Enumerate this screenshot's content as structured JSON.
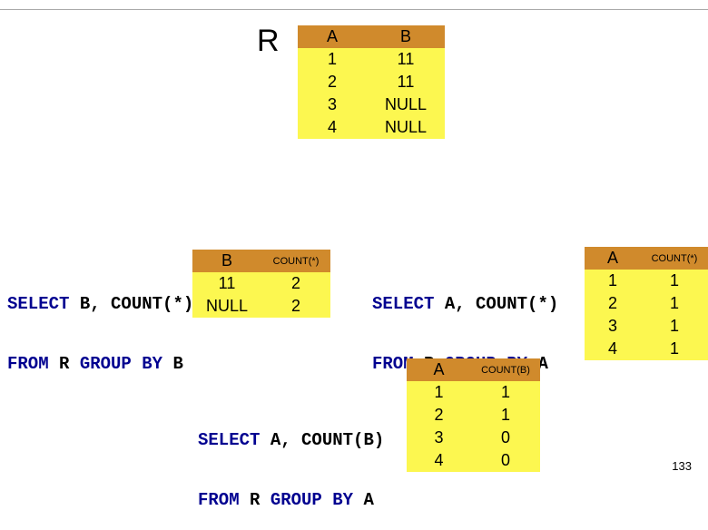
{
  "label_R": "R",
  "page_number": "133",
  "top_table": {
    "headers": [
      "A",
      "B"
    ],
    "rows": [
      [
        "1",
        "11"
      ],
      [
        "2",
        "11"
      ],
      [
        "3",
        "NULL"
      ],
      [
        "4",
        "NULL"
      ]
    ]
  },
  "sql1": {
    "line1": {
      "kw1": "SELECT ",
      "id1": "B, COUNT(*)"
    },
    "line2": {
      "kw1": "FROM ",
      "id1": "R ",
      "kw2": "GROUP BY ",
      "id2": "B"
    }
  },
  "table1": {
    "headers": [
      "B",
      "COUNT(*)"
    ],
    "rows": [
      [
        "11",
        "2"
      ],
      [
        "NULL",
        "2"
      ]
    ]
  },
  "sql2": {
    "line1": {
      "kw1": "SELECT ",
      "id1": "A, COUNT(*)"
    },
    "line2": {
      "kw1": "FROM ",
      "id1": "R ",
      "kw2": "GROUP BY ",
      "id2": "A"
    }
  },
  "table2": {
    "headers": [
      "A",
      "COUNT(*)"
    ],
    "rows": [
      [
        "1",
        "1"
      ],
      [
        "2",
        "1"
      ],
      [
        "3",
        "1"
      ],
      [
        "4",
        "1"
      ]
    ]
  },
  "sql3": {
    "line1": {
      "kw1": "SELECT ",
      "id1": "A, COUNT(B)"
    },
    "line2": {
      "kw1": "FROM ",
      "id1": "R ",
      "kw2": "GROUP BY ",
      "id2": "A"
    }
  },
  "table3": {
    "headers": [
      "A",
      "COUNT(B)"
    ],
    "rows": [
      [
        "1",
        "1"
      ],
      [
        "2",
        "1"
      ],
      [
        "3",
        "0"
      ],
      [
        "4",
        "0"
      ]
    ]
  }
}
